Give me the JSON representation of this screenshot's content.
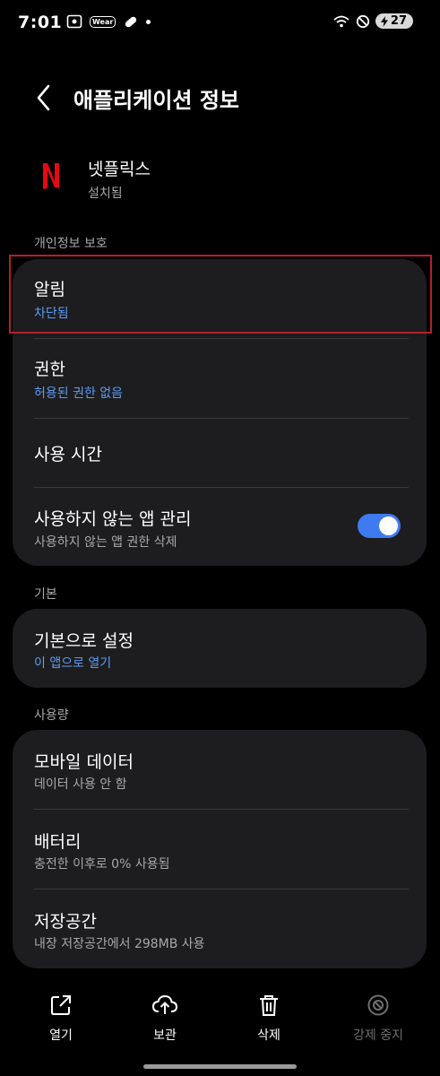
{
  "status_bar": {
    "time": "7:01",
    "wear_label": "Wear",
    "battery": "27"
  },
  "header": {
    "title": "애플리케이션 정보"
  },
  "app": {
    "name": "넷플릭스",
    "status": "설치됨",
    "logo_color": "#e50914"
  },
  "sections": {
    "privacy": {
      "label": "개인정보 보호",
      "notifications": {
        "title": "알림",
        "value": "차단됨"
      },
      "permissions": {
        "title": "권한",
        "value": "허용된 권한 없음"
      },
      "usage_time": {
        "title": "사용 시간"
      },
      "unused_apps": {
        "title": "사용하지 않는 앱 관리",
        "subtitle": "사용하지 않는 앱 권한 삭제",
        "enabled": true
      }
    },
    "defaults": {
      "label": "기본",
      "set_default": {
        "title": "기본으로 설정",
        "value": "이 앱으로 열기"
      }
    },
    "usage": {
      "label": "사용량",
      "mobile_data": {
        "title": "모바일 데이터",
        "subtitle": "데이터 사용 안 함"
      },
      "battery": {
        "title": "배터리",
        "subtitle": "충전한 이후로 0% 사용됨"
      },
      "storage": {
        "title": "저장공간",
        "subtitle": "내장 저장공간에서 298MB 사용"
      }
    }
  },
  "bottom_nav": {
    "open": "열기",
    "archive": "보관",
    "delete": "삭제",
    "force_stop": "강제 중지"
  },
  "colors": {
    "accent_blue": "#5b9cf5",
    "toggle_on": "#3e7af0",
    "card_bg": "#1d1d1f",
    "highlight_border": "#b3202a"
  }
}
